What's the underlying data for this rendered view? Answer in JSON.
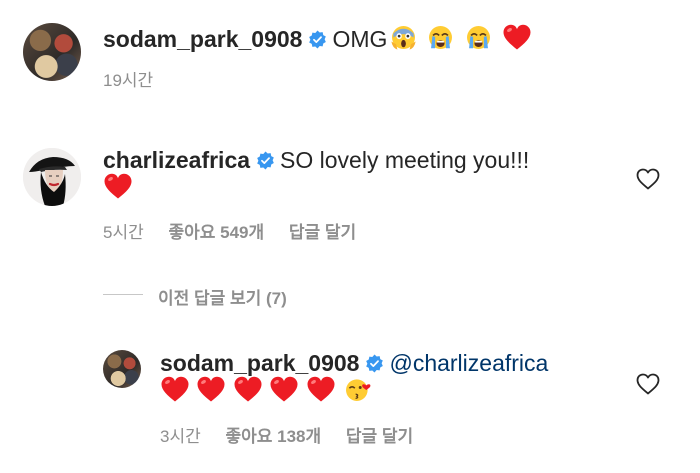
{
  "post": {
    "username": "sodam_park_0908",
    "caption": "OMG",
    "emojis": [
      "scream-emoji",
      "crying-emoji",
      "crying-emoji",
      "red-heart-emoji"
    ],
    "time": "19시간"
  },
  "comment": {
    "username": "charlizeafrica",
    "text": "SO lovely meeting you!!!",
    "emoji": "red-heart-emoji",
    "time": "5시간",
    "likes": "좋아요 549개",
    "reply_label": "답글 달기"
  },
  "view_replies": "이전 답글 보기 (7)",
  "reply": {
    "username": "sodam_park_0908",
    "mention": "@charlizeafrica",
    "emojis": [
      "red-heart-emoji",
      "red-heart-emoji",
      "red-heart-emoji",
      "red-heart-emoji",
      "red-heart-emoji",
      "kissing-heart-emoji"
    ],
    "time": "3시간",
    "likes": "좋아요 138개",
    "reply_label": "답글 달기"
  },
  "colors": {
    "text": "#262626",
    "secondary": "#8e8e8e",
    "verified": "#3897f0",
    "mention": "#003569",
    "heart": "#ed1c24"
  }
}
